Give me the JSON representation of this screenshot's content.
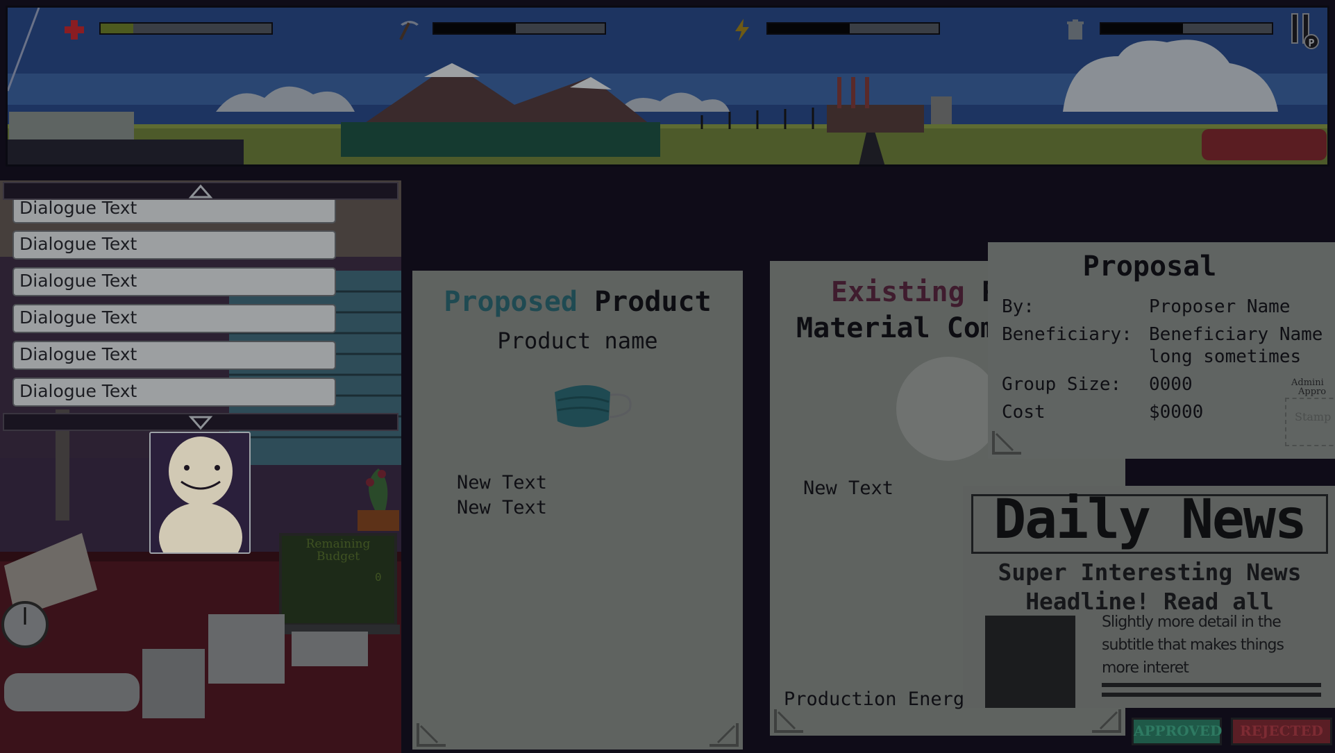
{
  "hud": {
    "stats": [
      {
        "icon": "health-cross-icon",
        "level": 0.19,
        "fill_color": "#4d5a1f"
      },
      {
        "icon": "pickaxe-icon",
        "level": 0.48,
        "fill_color": "#050507"
      },
      {
        "icon": "lightning-icon",
        "level": 0.48,
        "fill_color": "#050507"
      },
      {
        "icon": "trash-can-icon",
        "level": 0.48,
        "fill_color": "#050507"
      }
    ],
    "pause_key": "P"
  },
  "dialogue": {
    "lines": [
      "Dialogue Text",
      "Dialogue Text",
      "Dialogue Text",
      "Dialogue Text",
      "Dialogue Text",
      "Dialogue Text"
    ]
  },
  "desk": {
    "laptop_label": "Remaining Budget",
    "laptop_value": "0"
  },
  "proposed_product": {
    "title_a": "Proposed",
    "title_b": "Product",
    "product_name": "Product name",
    "line1": "New Text",
    "line2": "New Text"
  },
  "existing_product": {
    "title_a": "Existing",
    "title_b": "Pr",
    "subtitle": "Material Com",
    "line1": "New Text",
    "footer": "Production Energ"
  },
  "proposal": {
    "title": "Proposal",
    "by_label": "By:",
    "by_value": "Proposer Name",
    "beneficiary_label": "Beneficiary:",
    "beneficiary_value_1": "Beneficiary Name",
    "beneficiary_value_2": "long sometimes",
    "group_label": "Group Size:",
    "group_value": "0000",
    "cost_label": "Cost",
    "cost_value": "$0000",
    "admin_label_1": "Admini",
    "admin_label_2": "Appro",
    "stamp_label": "Stamp"
  },
  "newspaper": {
    "masthead": "Daily News",
    "headline_1": "Super Interesting News",
    "headline_2": "Headline! Read all",
    "subtitle_1": "Slightly more detail in the",
    "subtitle_2": "subtitle that makes things",
    "subtitle_3": "more interet"
  },
  "stamps": {
    "approved": "APPROVED",
    "rejected": "REJECTED"
  },
  "colors": {
    "proposed_accent": "#1f4a52",
    "existing_accent": "#3f1c2e",
    "approved": "#1f5948",
    "rejected": "#5a1e25"
  }
}
